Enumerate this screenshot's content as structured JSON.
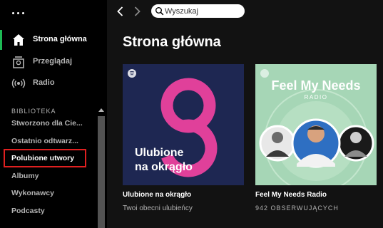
{
  "sidebar": {
    "nav": [
      {
        "label": "Strona główna",
        "icon": "home-icon",
        "active": true
      },
      {
        "label": "Przeglądaj",
        "icon": "browse-icon",
        "active": false
      },
      {
        "label": "Radio",
        "icon": "radio-icon",
        "active": false
      }
    ],
    "library_heading": "BIBLIOTEKA",
    "library": [
      {
        "label": "Stworzono dla Cie..."
      },
      {
        "label": "Ostatnio odtwarz..."
      },
      {
        "label": "Polubione utwory",
        "selected": true
      },
      {
        "label": "Albumy"
      },
      {
        "label": "Wykonawcy"
      },
      {
        "label": "Podcasty"
      }
    ]
  },
  "topbar": {
    "search_placeholder": "Wyszukaj"
  },
  "main": {
    "title": "Strona główna",
    "cards": [
      {
        "title": "Ulubione na okrągło",
        "subtitle": "Twoi obecni ulubieńcy",
        "cover_line1": "Ulubione",
        "cover_line2": "na okrągło"
      },
      {
        "title": "Feel My Needs Radio",
        "subtitle": "942 OBSERWUJĄCYCH",
        "cover_title": "Feel My Needs",
        "cover_label": "RADIO"
      }
    ]
  },
  "colors": {
    "accent": "#1db954",
    "highlight_box": "#e02020",
    "cover1_bg": "#1e2752",
    "cover1_shape": "#e0409a",
    "cover2_bg": "#a6d6b6"
  }
}
